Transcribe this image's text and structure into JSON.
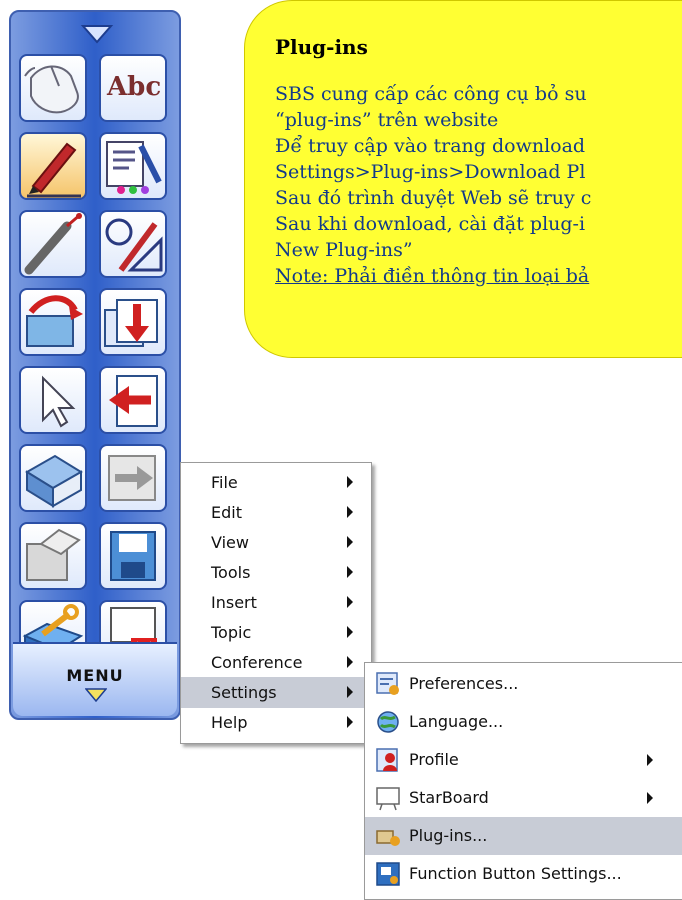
{
  "toolbar": {
    "text_tool_label": "Abc",
    "menu_label": "MENU"
  },
  "note": {
    "title": "Plug-ins",
    "lines": [
      "SBS cung cấp các công cụ bỏ su",
      "“plug-ins” trên website",
      "Để truy cập vào trang download",
      "Settings>Plug-ins>Download Pl",
      "Sau đó trình duyệt Web sẽ truy c",
      "Sau khi download, cài đặt plug-i",
      "New Plug-ins”",
      "Note: Phải điền thông tin loại bả"
    ]
  },
  "main_menu": {
    "items": [
      {
        "label": "File",
        "has_submenu": true
      },
      {
        "label": "Edit",
        "has_submenu": true
      },
      {
        "label": "View",
        "has_submenu": true
      },
      {
        "label": "Tools",
        "has_submenu": true
      },
      {
        "label": "Insert",
        "has_submenu": true
      },
      {
        "label": "Topic",
        "has_submenu": true
      },
      {
        "label": "Conference",
        "has_submenu": true
      },
      {
        "label": "Settings",
        "has_submenu": true,
        "selected": true
      },
      {
        "label": "Help",
        "has_submenu": true
      }
    ]
  },
  "settings_submenu": {
    "items": [
      {
        "label": "Preferences...",
        "icon": "preferences-icon"
      },
      {
        "label": "Language...",
        "icon": "language-icon"
      },
      {
        "label": "Profile",
        "icon": "profile-icon",
        "has_submenu": true
      },
      {
        "label": "StarBoard",
        "icon": "starboard-icon",
        "has_submenu": true
      },
      {
        "label": "Plug-ins...",
        "icon": "plugins-icon",
        "selected": true
      },
      {
        "label": "Function Button Settings...",
        "icon": "function-button-icon"
      }
    ]
  },
  "colors": {
    "note_bg": "#ffff33",
    "note_text": "#123a8a",
    "toolbar_blue": "#2f5fc9",
    "menu_highlight": "#c8ccd6"
  }
}
